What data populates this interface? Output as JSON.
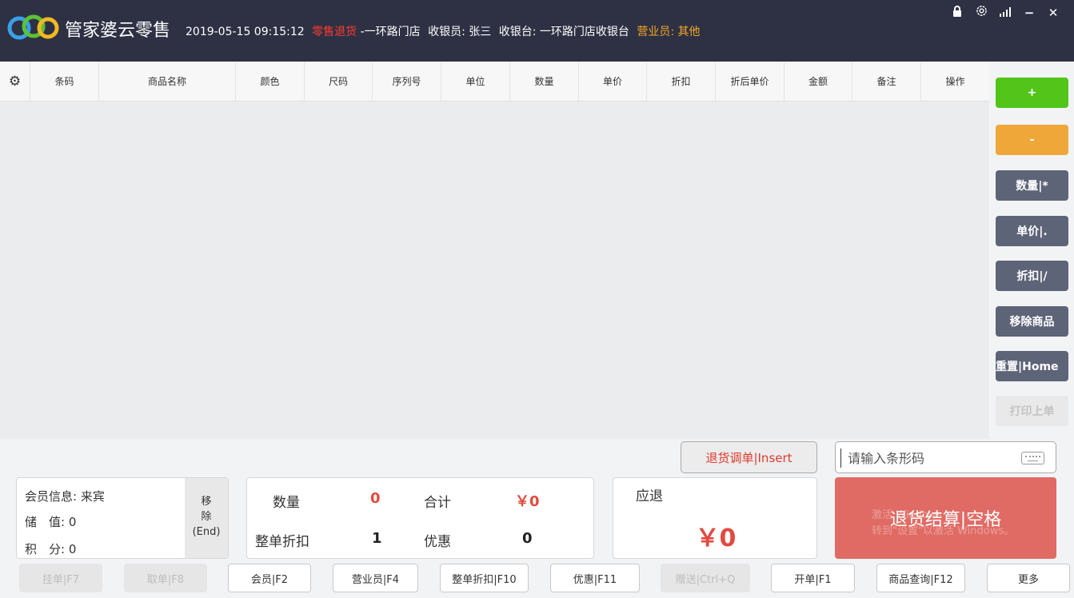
{
  "header": {
    "app_title": "管家婆云零售",
    "datetime": "2019-05-15 09:15:12",
    "mode": "零售退货",
    "store": "-一环路门店",
    "cashier": "收银员: 张三",
    "register": "收银台: 一环路门店收银台",
    "salesperson": "营业员: 其他",
    "icons": [
      "lock-icon",
      "settings-icon",
      "signal-icon",
      "minimize-icon",
      "close-icon"
    ]
  },
  "table": {
    "columns": [
      "条码",
      "商品名称",
      "颜色",
      "尺码",
      "序列号",
      "单位",
      "数量",
      "单价",
      "折扣",
      "折后单价",
      "金额",
      "备注",
      "操作"
    ],
    "rows": []
  },
  "sidebar": {
    "add": "+",
    "subtract": "-",
    "quantity": "数量|*",
    "price": "单价|.",
    "discount": "折扣|/",
    "remove_item": "移除商品",
    "reset": "重置|Home",
    "print_last": "打印上单"
  },
  "scan": {
    "return_adjust": "退货调单|Insert",
    "barcode_placeholder": "请输入条形码"
  },
  "member": {
    "info": "会员信息: 来宾",
    "balance": "储　值: 0",
    "points": "积　分: 0",
    "remove_line1": "移",
    "remove_line2": "除",
    "remove_line3": "(End)"
  },
  "stats": {
    "qty_label": "数量",
    "qty_value": "0",
    "total_label": "合计",
    "total_value": "￥0",
    "order_discount_label": "整单折扣",
    "order_discount_value": "1",
    "promo_label": "优惠",
    "promo_value": "0"
  },
  "refund": {
    "label": "应退",
    "amount": "￥0"
  },
  "checkout": {
    "label": "退货结算|空格",
    "watermark_line1": "激活 Windows",
    "watermark_line2": "转到\"设置\"以激活 Windows。"
  },
  "bottom_buttons": {
    "hold": "挂单|F7",
    "retrieve": "取单|F8",
    "member": "会员|F2",
    "salesperson": "营业员|F4",
    "order_discount": "整单折扣|F10",
    "promotion": "优惠|F11",
    "gift": "赠送|Ctrl+Q",
    "open_drawer": "开单|F1",
    "product_query": "商品查询|F12",
    "more": "更多"
  },
  "colors": {
    "header_bg": "#2e3144",
    "mode_red": "#ff3b30",
    "salesperson_orange": "#f5a623",
    "add_green": "#52c41a",
    "subtract_orange": "#f0a73a",
    "slate_button": "#5d6478",
    "checkout_red": "#e06b64",
    "amount_red": "#e3493e"
  }
}
